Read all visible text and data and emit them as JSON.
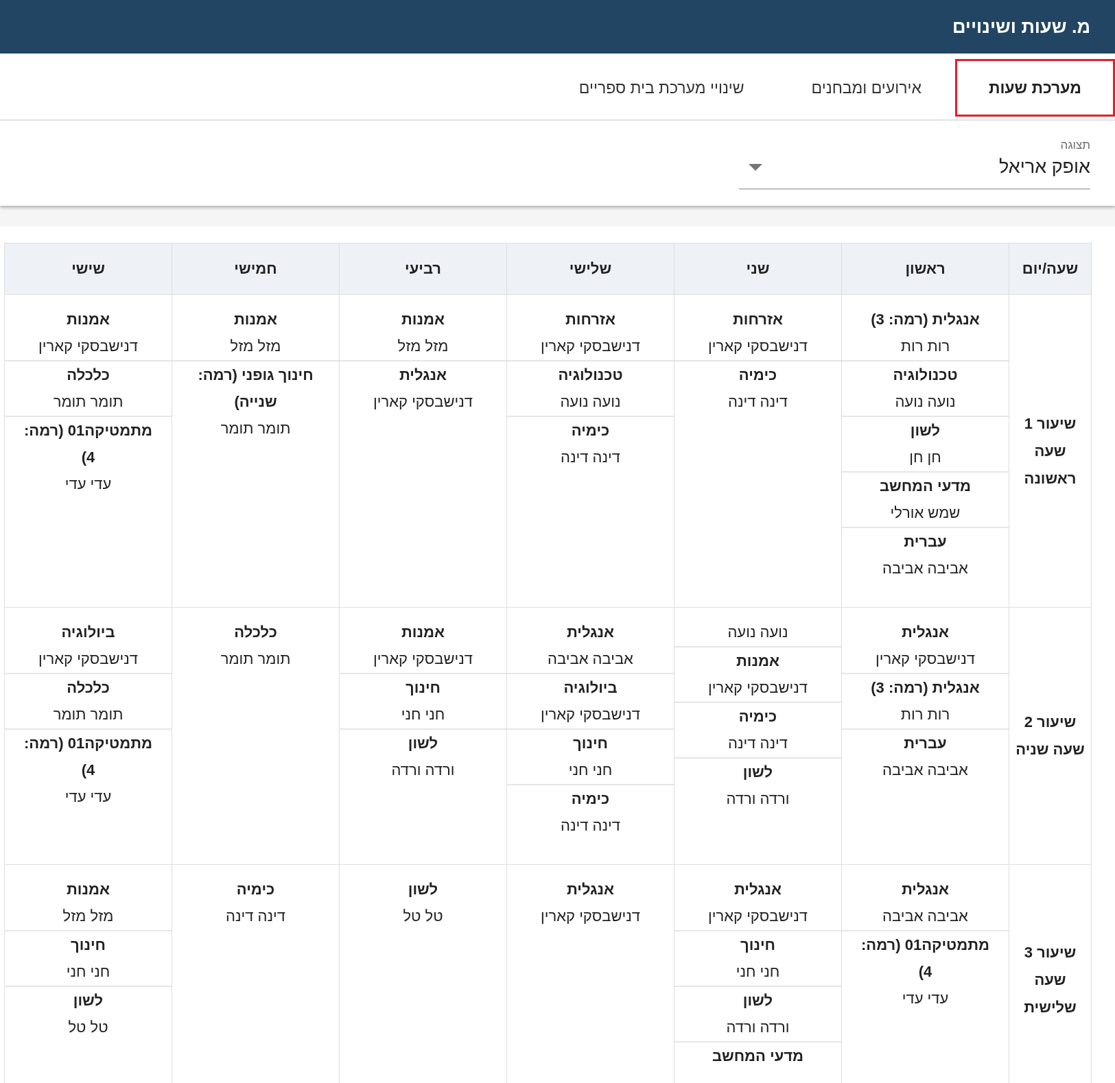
{
  "header": {
    "title": "מ. שעות ושינויים"
  },
  "tabs": [
    {
      "label": "מערכת שעות",
      "selected": true
    },
    {
      "label": "אירועים ומבחנים",
      "selected": false
    },
    {
      "label": "שינויי מערכת בית ספריים",
      "selected": false
    }
  ],
  "view_select": {
    "label": "תצוגה",
    "value": "אופק אריאל"
  },
  "table": {
    "columns": [
      "שעה/יום",
      "ראשון",
      "שני",
      "שלישי",
      "רביעי",
      "חמישי",
      "שישי"
    ],
    "rows": [
      {
        "hour": "שיעור 1 שעה ראשונה",
        "days": [
          [
            {
              "subject": "אנגלית (רמה: 3)",
              "teacher": "רות רות"
            },
            {
              "subject": "טכנולוגיה",
              "teacher": "נועה נועה"
            },
            {
              "subject": "לשון",
              "teacher": "חן חן"
            },
            {
              "subject": "מדעי המחשב",
              "teacher": "שמש אורלי"
            },
            {
              "subject": "עברית",
              "teacher": "אביבה אביבה"
            }
          ],
          [
            {
              "subject": "אזרחות",
              "teacher": "דנישבסקי קארין"
            },
            {
              "subject": "כימיה",
              "teacher": "דינה דינה"
            }
          ],
          [
            {
              "subject": "אזרחות",
              "teacher": "דנישבסקי קארין"
            },
            {
              "subject": "טכנולוגיה",
              "teacher": "נועה נועה"
            },
            {
              "subject": "כימיה",
              "teacher": "דינה דינה"
            }
          ],
          [
            {
              "subject": "אמנות",
              "teacher": "מזל מזל"
            },
            {
              "subject": "אנגלית",
              "teacher": "דנישבסקי קארין"
            }
          ],
          [
            {
              "subject": "אמנות",
              "teacher": "מזל מזל"
            },
            {
              "subject": "חינוך גופני (רמה: שנייה)",
              "teacher": "תומר תומר"
            }
          ],
          [
            {
              "subject": "אמנות",
              "teacher": "דנישבסקי קארין"
            },
            {
              "subject": "כלכלה",
              "teacher": "תומר תומר"
            },
            {
              "subject": "מתמטיקה01 (רמה: 4)",
              "teacher": "עדי עדי"
            }
          ]
        ]
      },
      {
        "hour": "שיעור 2 שעה שניה",
        "days": [
          [
            {
              "subject": "אנגלית",
              "teacher": "דנישבסקי קארין"
            },
            {
              "subject": "אנגלית (רמה: 3)",
              "teacher": "רות רות"
            },
            {
              "subject": "עברית",
              "teacher": "אביבה אביבה"
            }
          ],
          [
            {
              "teacher": "נועה נועה"
            },
            {
              "subject": "אמנות",
              "teacher": "דנישבסקי קארין"
            },
            {
              "subject": "כימיה",
              "teacher": "דינה דינה"
            },
            {
              "subject": "לשון",
              "teacher": "ורדה ורדה"
            }
          ],
          [
            {
              "subject": "אנגלית",
              "teacher": "אביבה אביבה"
            },
            {
              "subject": "ביולוגיה",
              "teacher": "דנישבסקי קארין"
            },
            {
              "subject": "חינוך",
              "teacher": "חני חני"
            },
            {
              "subject": "כימיה",
              "teacher": "דינה דינה"
            }
          ],
          [
            {
              "subject": "אמנות",
              "teacher": "דנישבסקי קארין"
            },
            {
              "subject": "חינוך",
              "teacher": "חני חני"
            },
            {
              "subject": "לשון",
              "teacher": "ורדה ורדה"
            }
          ],
          [
            {
              "subject": "כלכלה",
              "teacher": "תומר תומר"
            }
          ],
          [
            {
              "subject": "ביולוגיה",
              "teacher": "דנישבסקי קארין"
            },
            {
              "subject": "כלכלה",
              "teacher": "תומר תומר"
            },
            {
              "subject": "מתמטיקה01 (רמה: 4)",
              "teacher": "עדי עדי"
            }
          ]
        ]
      },
      {
        "hour": "שיעור 3 שעה שלישית",
        "days": [
          [
            {
              "subject": "אנגלית",
              "teacher": "אביבה אביבה"
            },
            {
              "subject": "מתמטיקה01 (רמה: 4)",
              "teacher": "עדי עדי"
            }
          ],
          [
            {
              "subject": "אנגלית",
              "teacher": "דנישבסקי קארין"
            },
            {
              "subject": "חינוך",
              "teacher": "חני חני"
            },
            {
              "subject": "לשון",
              "teacher": "ורדה ורדה"
            },
            {
              "subject": "מדעי המחשב"
            }
          ],
          [
            {
              "subject": "אנגלית",
              "teacher": "דנישבסקי קארין"
            }
          ],
          [
            {
              "subject": "לשון",
              "teacher": "טל טל"
            }
          ],
          [
            {
              "subject": "כימיה",
              "teacher": "דינה דינה"
            }
          ],
          [
            {
              "subject": "אמנות",
              "teacher": "מזל מזל"
            },
            {
              "subject": "חינוך",
              "teacher": "חני חני"
            },
            {
              "subject": "לשון",
              "teacher": "טל טל"
            }
          ]
        ]
      }
    ]
  }
}
